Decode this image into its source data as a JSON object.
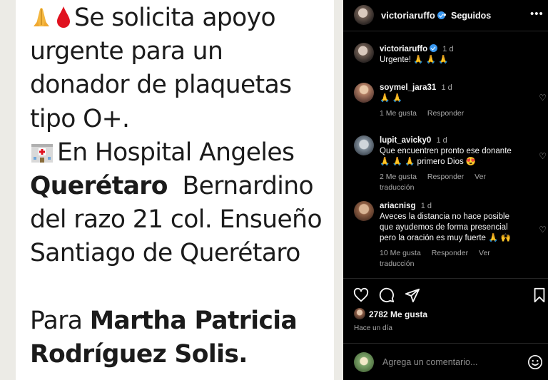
{
  "post_image": {
    "lines": [
      "Se solicita apoyo",
      "urgente para un",
      "donador de plaquetas",
      "tipo O+.",
      "En Hospital Angeles",
      "Querétaro",
      "Bernardino",
      "del razo 21 col. Ensueño",
      "Santiago de Querétaro",
      "Para ",
      "Martha Patricia",
      "Rodríguez Solis."
    ]
  },
  "header": {
    "username": "victoriaruffo",
    "dot": "•",
    "follow_label": "Seguidos",
    "more": "•••"
  },
  "comments": [
    {
      "user": "victoriaruffo",
      "time": "1 d",
      "text": "Urgente! 🙏 🙏 🙏",
      "verified": true
    },
    {
      "user": "soymel_jara31",
      "time": "1 d",
      "text": "🙏 🙏",
      "likes": "1 Me gusta",
      "reply": "Responder"
    },
    {
      "user": "lupit_avicky0",
      "time": "1 d",
      "text1": "Que encuentren pronto ese donante",
      "text2": "🙏 🙏 🙏 primero Dios 😍",
      "likes": "2 Me gusta",
      "reply": "Responder",
      "translate": "Ver traducción"
    },
    {
      "user": "ariacnisg",
      "time": "1 d",
      "text1": "Aveces la distancia no hace posible",
      "text2": "que ayudemos de forma presencial",
      "text3": "pero la oración es muy fuerte 🙏 🙌",
      "likes": "10 Me gusta",
      "reply": "Responder",
      "translate": "Ver traducción"
    }
  ],
  "footer": {
    "likes": "2782 Me gusta",
    "ago": "Hace un día",
    "comment_placeholder": "Agrega un comentario..."
  },
  "icons": [
    "heart-icon",
    "comment-icon",
    "share-icon",
    "bookmark-icon",
    "emoji-icon"
  ],
  "colors": {
    "verified": "#3897f0",
    "panel_bg": "#000000",
    "muted": "#a8a8a8"
  }
}
